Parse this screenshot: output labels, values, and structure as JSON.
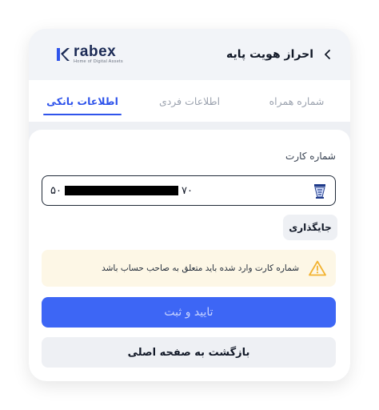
{
  "header": {
    "title": "احراز هویت پایه",
    "logo": {
      "word": "rabex",
      "tagline": "Home of Digital Assets",
      "brand_color": "#2f54eb"
    }
  },
  "tabs": [
    {
      "label": "شماره همراه",
      "active": false
    },
    {
      "label": "اطلاعات فردی",
      "active": false
    },
    {
      "label": "اطلاعات بانکی",
      "active": true
    }
  ],
  "form": {
    "card_label": "شماره کارت",
    "card_prefix": "۵۰",
    "card_suffix": "۷۰",
    "paste_label": "جایگذاری",
    "warning_text": "شماره کارت وارد شده باید متعلق به صاحب حساب باشد",
    "submit_label": "تایید و ثبت",
    "back_label": "بازگشت به صفحه اصلی"
  },
  "colors": {
    "accent": "#3d66f5",
    "warning_bg": "#fdf7e6",
    "warning_icon": "#f2b230"
  }
}
